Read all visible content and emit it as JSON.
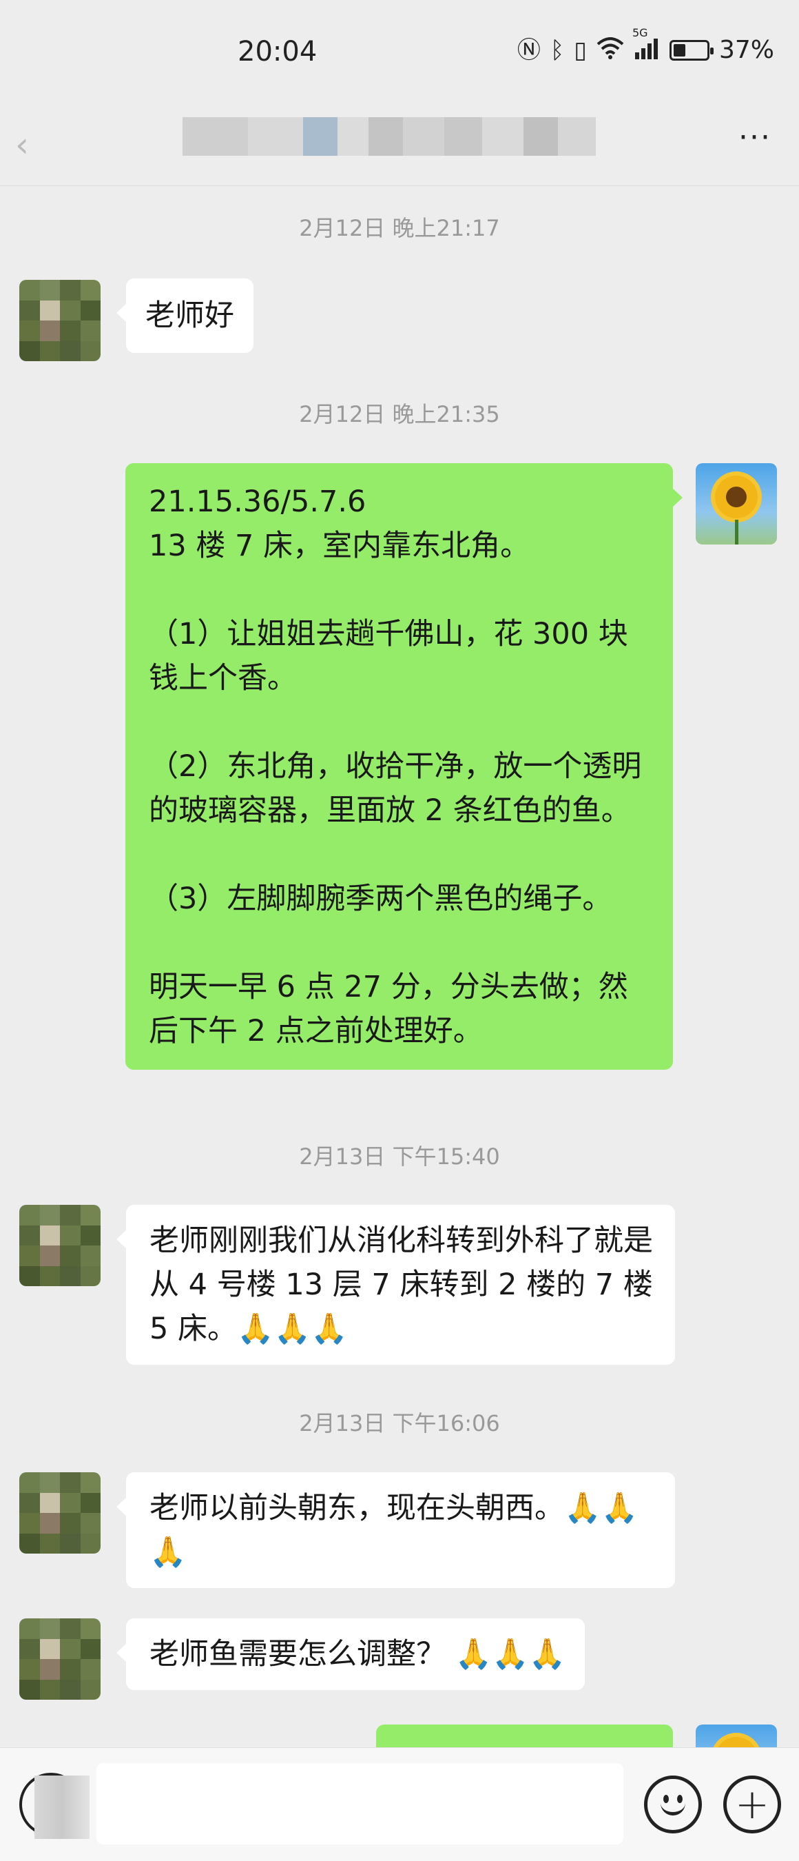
{
  "status_bar": {
    "time": "20:04",
    "network": "5G",
    "battery_level": 37,
    "battery_text": "37%",
    "icons": [
      "nfc-icon",
      "bluetooth-icon",
      "vibrate-icon",
      "wifi-icon",
      "signal-icon",
      "battery-icon"
    ]
  },
  "header": {
    "back_icon": "back-icon",
    "more_label": "···"
  },
  "messages": [
    {
      "type": "timestamp",
      "text": "2月12日 晚上21:17"
    },
    {
      "type": "incoming",
      "text": "老师好"
    },
    {
      "type": "timestamp",
      "text": "2月12日 晚上21:35"
    },
    {
      "type": "outgoing",
      "text": "21.15.36/5.7.6\n13 楼 7 床，室内靠东北角。\n\n（1）让姐姐去趟千佛山，花 300 块钱上个香。\n\n（2）东北角，收拾干净，放一个透明的玻璃容器，里面放 2 条红色的鱼。\n\n（3）左脚脚腕季两个黑色的绳子。\n\n明天一早 6 点 27 分，分头去做；然后下午 2 点之前处理好。"
    },
    {
      "type": "timestamp",
      "text": "2月13日 下午15:40"
    },
    {
      "type": "incoming",
      "text": "老师刚刚我们从消化科转到外科了就是从 4 号楼 13 层 7 床转到 2 楼的 7 楼 5 床。🙏🙏🙏"
    },
    {
      "type": "timestamp",
      "text": "2月13日 下午16:06"
    },
    {
      "type": "incoming",
      "text": "老师以前头朝东，现在头朝西。🙏🙏🙏"
    },
    {
      "type": "incoming",
      "text": "老师鱼需要怎么调整？ 🙏🙏🙏"
    }
  ],
  "input_bar": {
    "emoji_icon": "emoji-icon",
    "plus_label": "+"
  },
  "colors": {
    "background": "#ededed",
    "outgoing_bubble": "#95ec69",
    "incoming_bubble": "#ffffff",
    "timestamp": "#999999"
  }
}
